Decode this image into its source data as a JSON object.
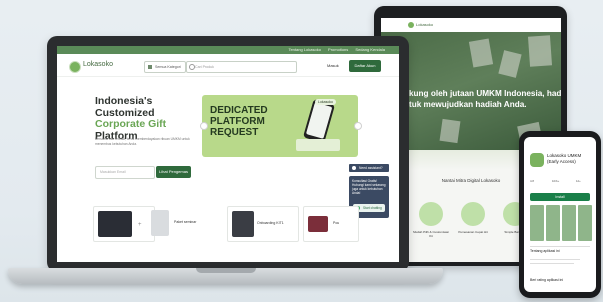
{
  "laptop": {
    "topbar_links": [
      "Tentang Lokasoko",
      "Promotions",
      "Sedang Kendala"
    ],
    "brand": "Lokasoko",
    "category_button": "Semua Kategori",
    "search_placeholder": "Cari Produk",
    "login_label": "Masuk",
    "signup_label": "Daftar Akun",
    "hero": {
      "line1": "Indonesia's",
      "line2": "Customized",
      "line3": "Corporate Gift",
      "line4": "Platform",
      "subtitle": "Bersama kita terbaik, terus memberdayakan ribuan UMKM untuk menembus kebutuhan Anda.",
      "email_placeholder": "Masukkan Email",
      "cta_label": "Lihat Pengemas"
    },
    "banner": {
      "text": "DEDICATED PLATFORM REQUEST",
      "logo": "Lokasoko"
    },
    "chat": {
      "header": "Need assistant?",
      "body": "Konsultasi Gratis! Hubungi kami sekarang juga untuk kebutuhan Anda!",
      "wa_label": "Start chatting"
    },
    "products": [
      {
        "label": "Paket seminar"
      },
      {
        "label": "Paket welcoming kit"
      },
      {
        "label": "Onboarding KIT1"
      },
      {
        "label": "Pou"
      }
    ]
  },
  "tablet": {
    "brand": "Lokasoko",
    "hero_text": "dukung oleh jutaan UMKM Indonesia, hadir untuk mewujudkan hadiah Anda.",
    "section_title": "Nantai Mitra Digital Lokasoko",
    "features": [
      "Mudah Pilih & Customisasi Kit",
      "Pemesanan Cepat Hit",
      "Simple Barcode"
    ]
  },
  "phone": {
    "app_title": "Lokasoko UMKM (Early Access)",
    "install_label": "Install",
    "about_label": "Tentang aplikasi ini",
    "rating_label": "Beri rating aplikasi ini",
    "stats": [
      "4.8",
      "10rb+",
      "12+"
    ]
  }
}
